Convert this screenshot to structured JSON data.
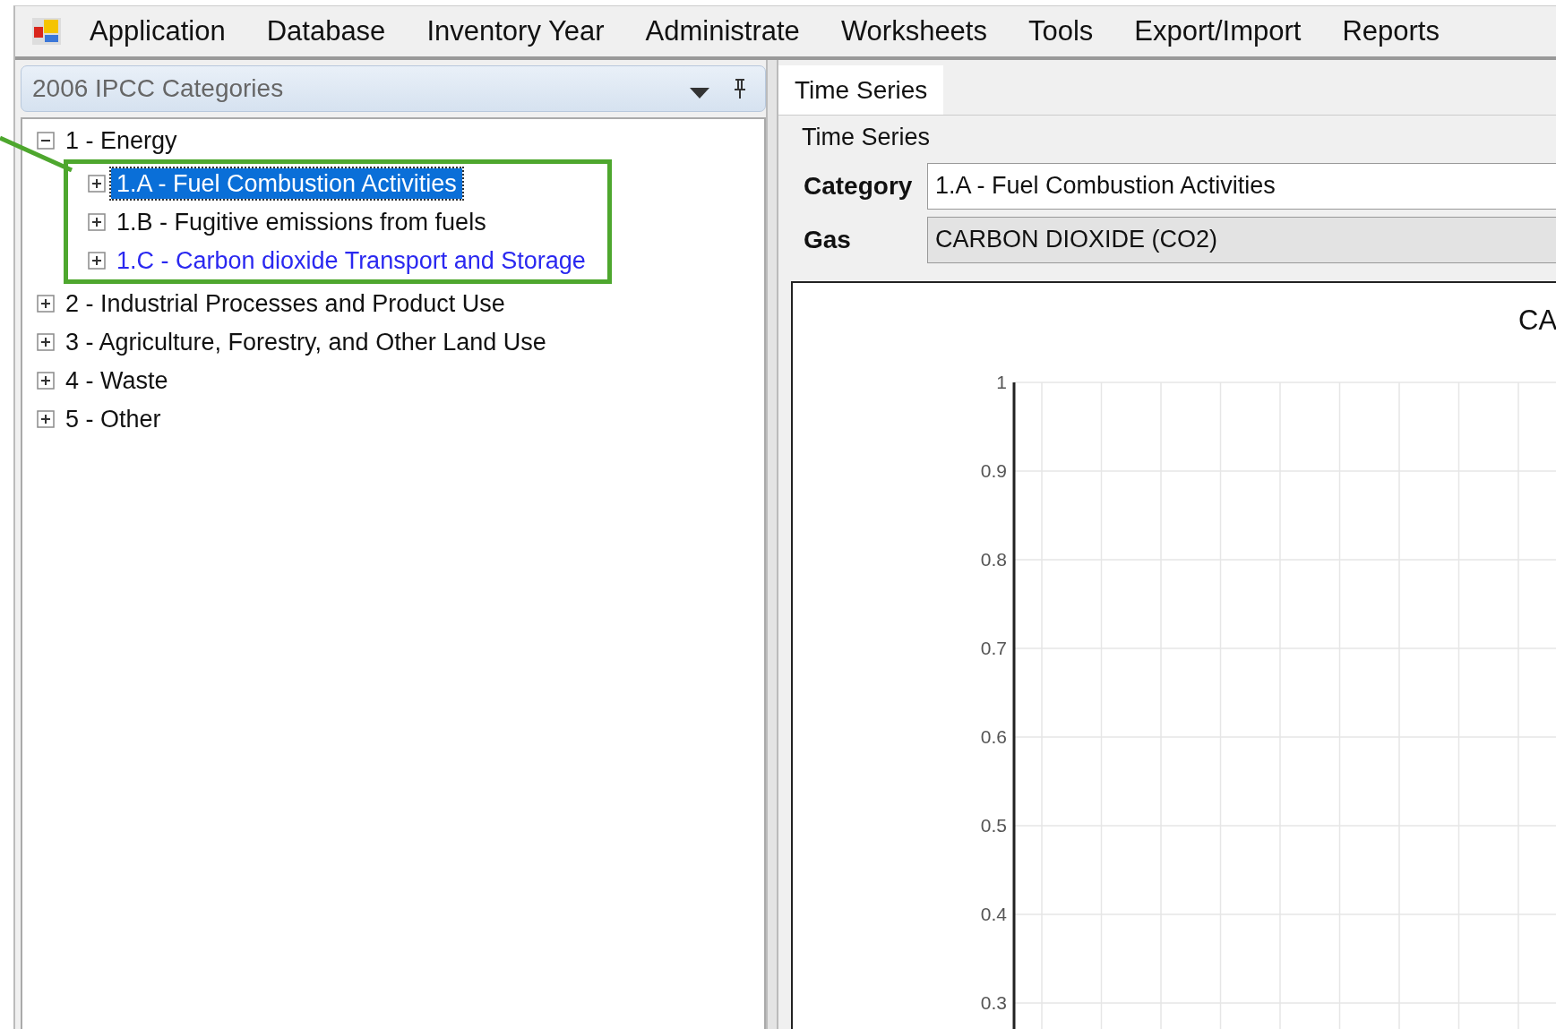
{
  "menu": [
    {
      "label": "Application",
      "kind": "app"
    },
    {
      "label": "Database"
    },
    {
      "label": "Inventory Year"
    },
    {
      "label": "Administrate"
    },
    {
      "label": "Worksheets"
    },
    {
      "label": "Tools"
    },
    {
      "label": "Export/Import"
    },
    {
      "label": "Reports"
    }
  ],
  "categories_panel": {
    "title": "2006 IPCC Categories",
    "tree": [
      {
        "label": "1 - Energy",
        "expanded": true,
        "selected": false,
        "hovered": false,
        "framed": true,
        "children": [
          {
            "label": "1.A - Fuel Combustion Activities",
            "expanded": false,
            "selected": true,
            "hovered": false
          },
          {
            "label": "1.B - Fugitive emissions from fuels",
            "expanded": false,
            "selected": false,
            "hovered": false
          },
          {
            "label": "1.C - Carbon dioxide Transport and Storage",
            "expanded": false,
            "selected": false,
            "hovered": true
          }
        ]
      },
      {
        "label": "2 - Industrial Processes and Product Use",
        "expanded": false,
        "selected": false,
        "hovered": false
      },
      {
        "label": "3 - Agriculture, Forestry, and Other Land Use",
        "expanded": false,
        "selected": false,
        "hovered": false
      },
      {
        "label": "4 - Waste",
        "expanded": false,
        "selected": false,
        "hovered": false
      },
      {
        "label": "5 - Other",
        "expanded": false,
        "selected": false,
        "hovered": false
      }
    ]
  },
  "tabs": [
    {
      "label": "Time Series",
      "selected": true
    }
  ],
  "time_series": {
    "group_title": "Time Series",
    "fields": [
      {
        "label": "Category",
        "value": "1.A - Fuel Combustion Activities",
        "disabled": false
      },
      {
        "label": "Gas",
        "value": "CARBON DIOXIDE (CO2)",
        "disabled": true
      }
    ],
    "chart": {
      "title": "CA",
      "y_axis_labels": [
        "1",
        "0.9",
        "0.8",
        "0.7",
        "0.6",
        "0.5",
        "0.4",
        "0.3"
      ]
    }
  }
}
